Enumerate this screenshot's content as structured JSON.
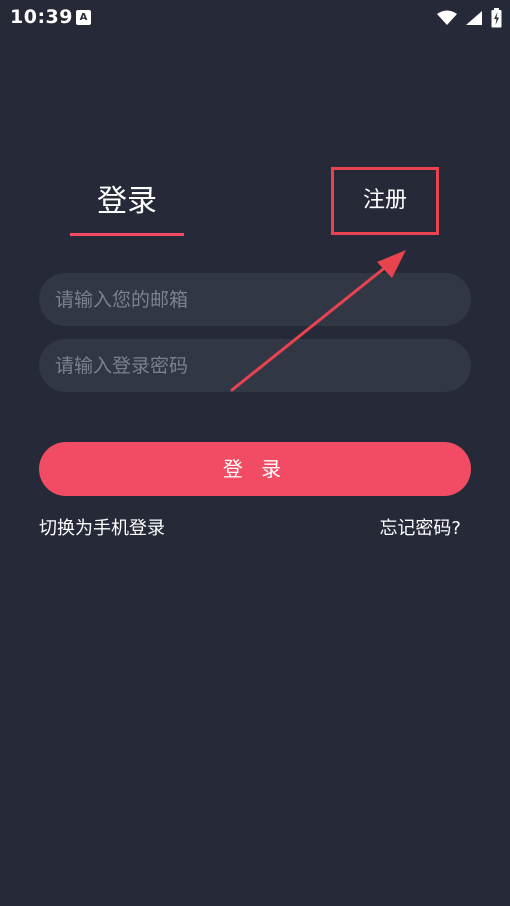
{
  "status_bar": {
    "time": "10:39",
    "notification_icon": "A"
  },
  "tabs": {
    "login_label": "登录",
    "register_label": "注册"
  },
  "form": {
    "email_placeholder": "请输入您的邮箱",
    "password_placeholder": "请输入登录密码",
    "login_button_label": "登 录"
  },
  "links": {
    "switch_phone_label": "切换为手机登录",
    "forgot_password_label": "忘记密码?"
  },
  "colors": {
    "background": "#262a38",
    "input_background": "#323746",
    "accent": "#f24b64",
    "annotation": "#e8434f"
  }
}
